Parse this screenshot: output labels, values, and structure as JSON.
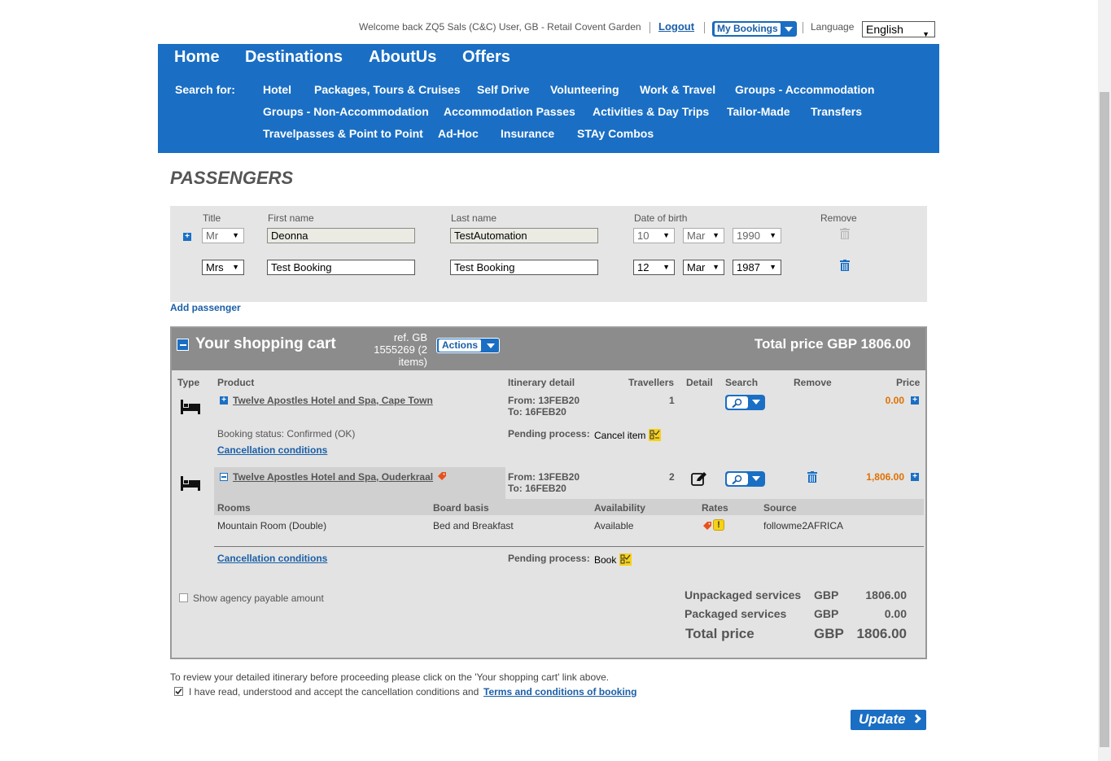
{
  "header": {
    "welcome": "Welcome back ZQ5 Sals (C&C) User, GB - Retail Covent Garden",
    "logout": "Logout",
    "my_bookings": "My Bookings",
    "language_label": "Language",
    "language_value": "English"
  },
  "nav": {
    "top": [
      "Home",
      "Destinations",
      "AboutUs",
      "Offers"
    ],
    "search_for": "Search for:",
    "links": [
      "Hotel",
      "Packages, Tours & Cruises",
      "Self Drive",
      "Volunteering",
      "Work & Travel",
      "Groups - Accommodation",
      "Groups - Non-Accommodation",
      "Accommodation Passes",
      "Activities & Day Trips",
      "Tailor-Made",
      "Transfers",
      "Travelpasses & Point to Point",
      "Ad-Hoc",
      "Insurance",
      "STAy Combos"
    ]
  },
  "passengers": {
    "title": "PASSENGERS",
    "labels": {
      "title": "Title",
      "first": "First name",
      "last": "Last name",
      "dob": "Date of birth",
      "remove": "Remove"
    },
    "rows": [
      {
        "title": "Mr",
        "first": "Deonna",
        "last": "TestAutomation",
        "day": "10",
        "month": "Mar",
        "year": "1990"
      },
      {
        "title": "Mrs",
        "first": "Test Booking",
        "last": "Test Booking",
        "day": "12",
        "month": "Mar",
        "year": "1987"
      }
    ],
    "add_passenger": "Add passenger"
  },
  "cart": {
    "title": "Your shopping cart",
    "ref_line1": "ref. GB",
    "ref_line2": "1555269 (2",
    "ref_line3": "items)",
    "actions": "Actions",
    "total_price": "Total price GBP 1806.00",
    "columns": {
      "type": "Type",
      "product": "Product",
      "itinerary": "Itinerary detail",
      "travellers": "Travellers",
      "detail": "Detail",
      "search": "Search",
      "remove": "Remove",
      "price": "Price"
    },
    "items": [
      {
        "product": "Twelve Apostles Hotel and Spa, Cape Town",
        "from": "From: 13FEB20",
        "to": "To: 16FEB20",
        "travellers": "1",
        "price": "0.00",
        "status": "Booking status: Confirmed (OK)",
        "pending_label": "Pending process:",
        "pending_value": "Cancel item",
        "cancellation": "Cancellation conditions"
      },
      {
        "product": "Twelve Apostles Hotel and Spa, Ouderkraal",
        "from": "From: 13FEB20",
        "to": "To: 16FEB20",
        "travellers": "2",
        "price": "1,806.00",
        "pending_label": "Pending process:",
        "pending_value": "Book",
        "cancellation": "Cancellation conditions"
      }
    ],
    "sub": {
      "headers": {
        "rooms": "Rooms",
        "board": "Board basis",
        "availability": "Availability",
        "rates": "Rates",
        "source": "Source"
      },
      "room": "Mountain Room (Double)",
      "board": "Bed and Breakfast",
      "availability": "Available",
      "source": "followme2AFRICA"
    },
    "agency_payable": "Show agency payable amount",
    "summary": {
      "unpackaged_label": "Unpackaged services",
      "unpackaged_cur": "GBP",
      "unpackaged_val": "1806.00",
      "packaged_label": "Packaged services",
      "packaged_cur": "GBP",
      "packaged_val": "0.00",
      "total_label": "Total price",
      "total_cur": "GBP",
      "total_val": "1806.00"
    }
  },
  "footer": {
    "note": "To review your detailed itinerary before proceeding please click on the 'Your shopping cart' link above.",
    "agree": "I have read, understood and accept the cancellation conditions and",
    "terms": "Terms and conditions of booking",
    "update": "Update"
  },
  "colors": {
    "brand_blue": "#1a6fc4",
    "price_orange": "#e07000",
    "cart_header": "#8c8c8c"
  }
}
